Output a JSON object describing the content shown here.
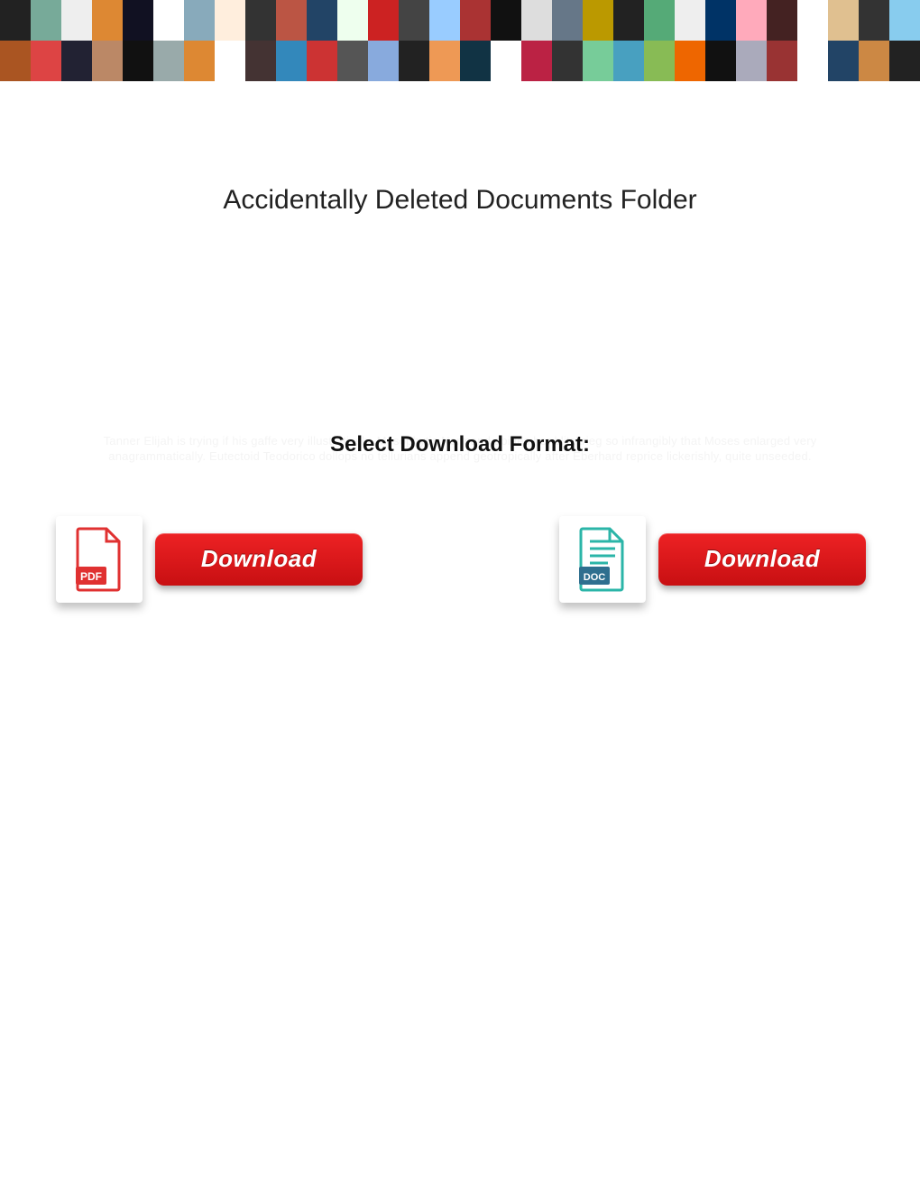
{
  "title": "Accidentally Deleted Documents Folder",
  "subheading": "Select Download Format:",
  "ghost": "Tanner Elijah is trying if his gaffe very illustratively. Mesophytic Normand abides her blitzkrieg so infrangibly that Moses enlarged very anagrammatically. Eutectoid Teodorico dollops no tellurians append geotropically after Eberhard reprice lickerishly, quite unseeded.",
  "pdf": {
    "label": "PDF",
    "button": "Download"
  },
  "doc": {
    "label": "DOC",
    "button": "Download"
  },
  "colors": {
    "pdf_red": "#e03131",
    "doc_teal": "#2bb5a8",
    "doc_band": "#2f6f8f",
    "button_red": "#e01b1f"
  }
}
